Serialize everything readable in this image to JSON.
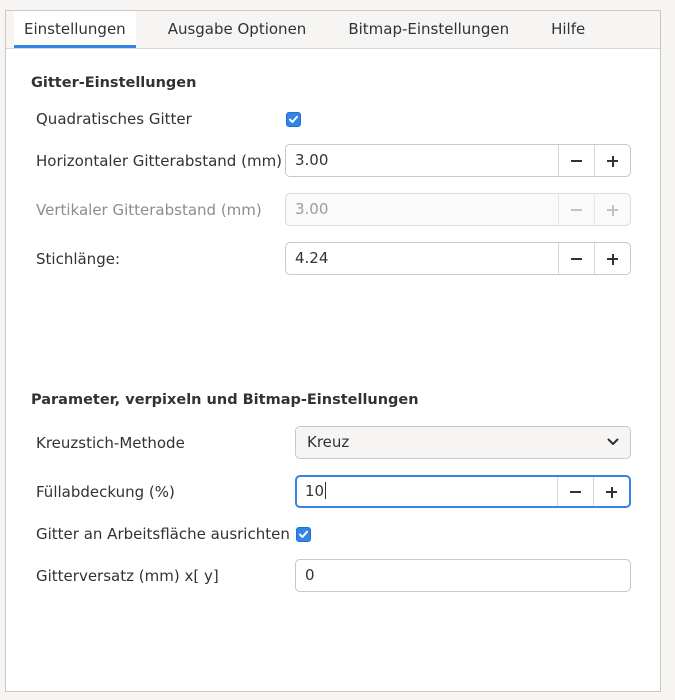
{
  "tabs": [
    {
      "label": "Einstellungen",
      "active": true
    },
    {
      "label": "Ausgabe Optionen",
      "active": false
    },
    {
      "label": "Bitmap-Einstellungen",
      "active": false
    },
    {
      "label": "Hilfe",
      "active": false
    }
  ],
  "grid_section": {
    "title": "Gitter-Einstellungen",
    "square_grid": {
      "label": "Quadratisches Gitter",
      "checked": true
    },
    "horizontal_spacing": {
      "label": "Horizontaler Gitterabstand (mm)",
      "value": "3.00"
    },
    "vertical_spacing": {
      "label": "Vertikaler Gitterabstand (mm)",
      "value": "3.00",
      "disabled": true
    },
    "stitch_length": {
      "label": "Stichlänge:",
      "value": "4.24"
    }
  },
  "params_section": {
    "title": "Parameter, verpixeln und Bitmap-Einstellungen",
    "cross_method": {
      "label": "Kreuzstich-Methode",
      "selected": "Kreuz"
    },
    "fill_coverage": {
      "label": "Füllabdeckung (%)",
      "value": "10",
      "focused": true
    },
    "align_grid": {
      "label": "Gitter an Arbeitsfläche ausrichten",
      "checked": true
    },
    "grid_offset": {
      "label": "Gitterversatz (mm) x[ y]",
      "value": "0"
    }
  },
  "icons": {
    "checkmark": "check-icon",
    "decrement": "minus-icon",
    "increment": "plus-icon",
    "dropdown": "chevron-down-icon"
  },
  "colors": {
    "accent": "#3584e4",
    "window_bg": "#ffffff",
    "chrome_bg": "#f6f5f4",
    "border": "#cdc7c2",
    "text": "#2e3436",
    "disabled_text": "#8b8e8f"
  }
}
